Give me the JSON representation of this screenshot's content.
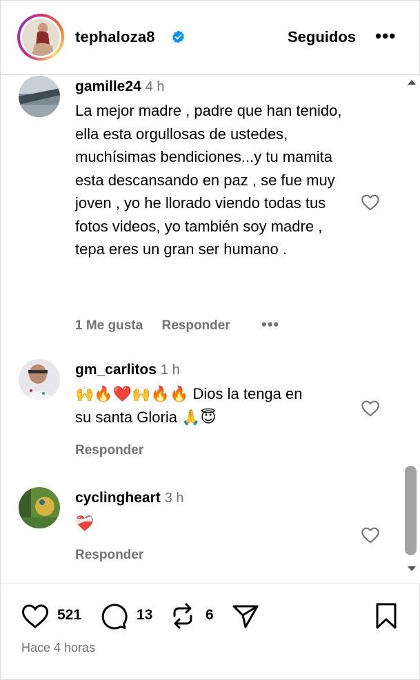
{
  "header": {
    "username": "tephaloza8",
    "follow_label": "Seguidos",
    "more_label": "•••",
    "icons": {
      "verified": "verified-badge-icon",
      "more": "more-options-icon"
    },
    "colors": {
      "verified": "#0095f6"
    }
  },
  "comments": [
    {
      "username": "gamille24",
      "time": "4 h",
      "text": "La mejor madre , padre que han tenido, ella esta orgullosas de ustedes, muchísimas bendiciones...y tu mamita esta descansando en paz , se fue muy joven , yo he llorado viendo todas tus fotos videos, yo también soy madre , tepa eres un gran ser humano .",
      "likes_label": "1 Me gusta",
      "reply_label": "Responder",
      "more_label": "•••"
    },
    {
      "username": "gm_carlitos",
      "time": "1 h",
      "emojis": "🙌🔥❤️🙌🔥🔥",
      "text_line1": "Dios la tenga en",
      "text_line2": "su santa Gloria",
      "emojis_end": "🙏😇",
      "reply_label": "Responder"
    },
    {
      "username": "cyclingheart",
      "time": "3 h",
      "emojis": "❤️‍🩹",
      "reply_label": "Responder"
    }
  ],
  "footer": {
    "likes_count": "521",
    "comments_count": "13",
    "reposts_count": "6",
    "time_ago": "Hace 4 horas",
    "icons": {
      "like": "heart-icon",
      "comment": "comment-icon",
      "repost": "repost-icon",
      "share": "share-icon",
      "save": "bookmark-icon"
    }
  }
}
